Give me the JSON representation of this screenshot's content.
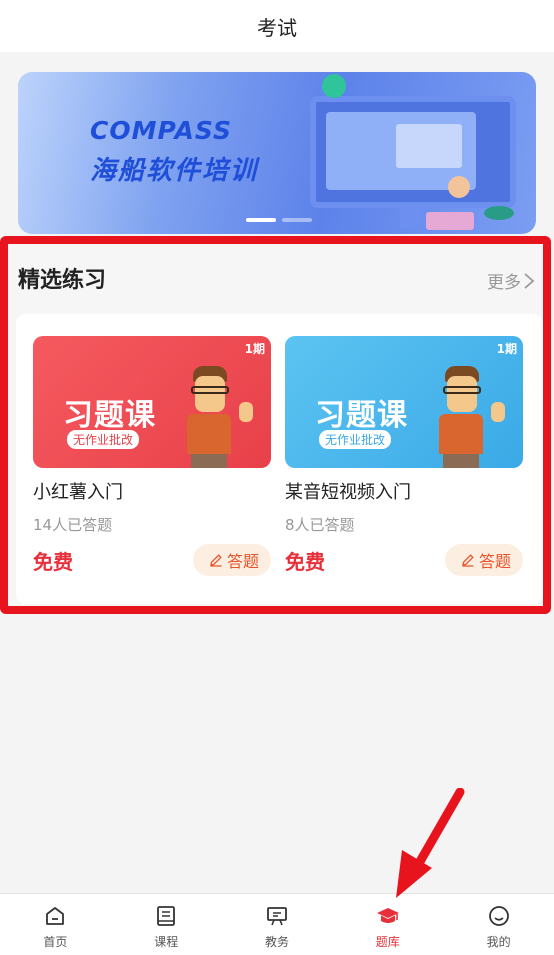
{
  "header": {
    "title": "考试"
  },
  "banner": {
    "brand": "COMPASS",
    "slogan": "海船软件培训",
    "slide_index": 1,
    "slide_count": 2
  },
  "practice": {
    "title": "精选练习",
    "more_label": "更多",
    "items": [
      {
        "thumb_period": "1期",
        "thumb_title": "习题课",
        "thumb_tag": "无作业批改",
        "thumb_color": "#e8404a",
        "name": "小红薯入门",
        "count": "14人已答题",
        "price": "免费",
        "action_label": "答题"
      },
      {
        "thumb_period": "1期",
        "thumb_title": "习题课",
        "thumb_tag": "无作业批改",
        "thumb_color": "#3aa9e6",
        "name": "某音短视频入门",
        "count": "8人已答题",
        "price": "免费",
        "action_label": "答题"
      }
    ]
  },
  "tabbar": {
    "active_index": 3,
    "items": [
      {
        "label": "首页",
        "icon": "home-icon"
      },
      {
        "label": "课程",
        "icon": "book-icon"
      },
      {
        "label": "教务",
        "icon": "board-icon"
      },
      {
        "label": "题库",
        "icon": "graduation-cap-icon"
      },
      {
        "label": "我的",
        "icon": "smiley-icon"
      }
    ]
  },
  "colors": {
    "accent": "#e8303a",
    "highlight_border": "#e8141d",
    "action_bg": "#fdeee2"
  }
}
